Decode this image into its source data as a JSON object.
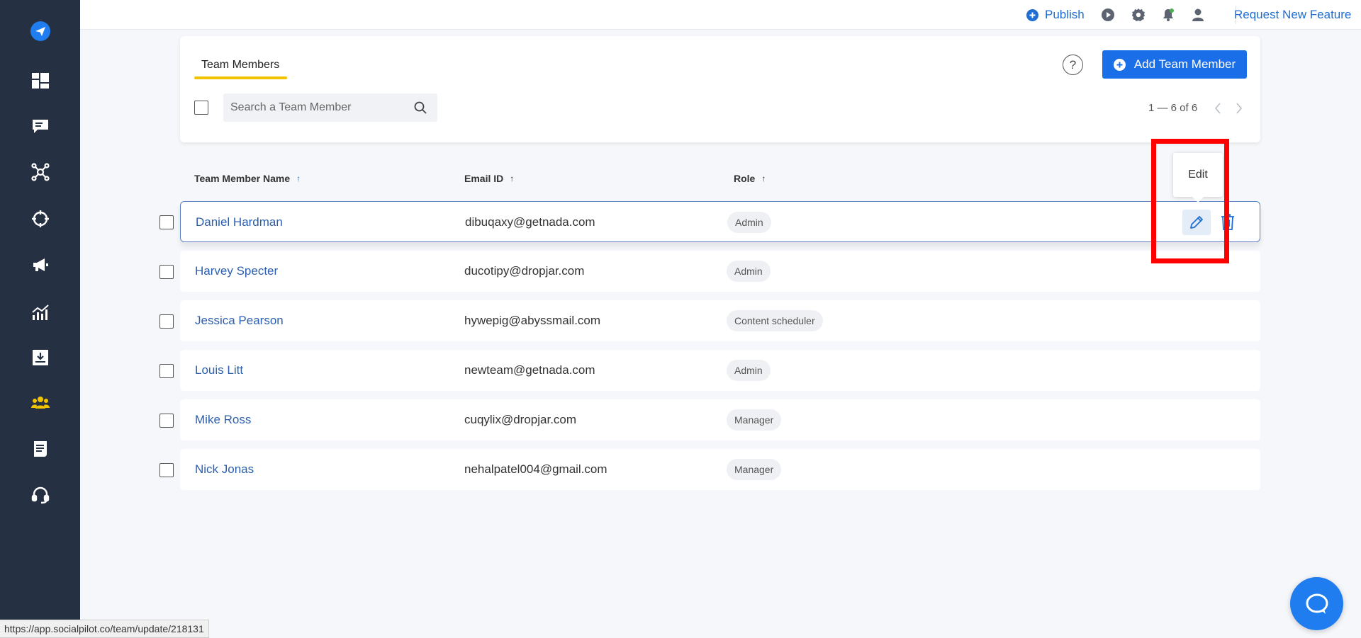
{
  "sidebar": {
    "items": [
      {
        "icon": "send-logo-icon",
        "active": true
      },
      {
        "icon": "dashboard-icon"
      },
      {
        "icon": "messages-icon"
      },
      {
        "icon": "connections-icon"
      },
      {
        "icon": "target-icon"
      },
      {
        "icon": "megaphone-icon"
      },
      {
        "icon": "analytics-icon"
      },
      {
        "icon": "inbox-download-icon"
      },
      {
        "icon": "team-icon",
        "active": true
      },
      {
        "icon": "reports-icon"
      },
      {
        "icon": "support-headset-icon"
      }
    ],
    "colors": {
      "bg": "#253042",
      "icon": "#ffffff",
      "active_accent": "#f2c300"
    }
  },
  "topbar": {
    "publish_label": "Publish",
    "request_label": "Request New Feature",
    "icons": [
      "play-icon",
      "gear-icon",
      "bell-icon",
      "user-icon"
    ]
  },
  "panel": {
    "tab_label": "Team Members",
    "help_icon": "?",
    "add_button_label": "Add Team Member",
    "search_placeholder": "Search a Team Member",
    "pagination": "1 — 6 of 6"
  },
  "table": {
    "headers": {
      "name": "Team Member Name",
      "email": "Email ID",
      "role": "Role"
    },
    "sort_arrow": "↑",
    "rows": [
      {
        "name": "Daniel Hardman",
        "email": "dibuqaxy@getnada.com",
        "role": "Admin"
      },
      {
        "name": "Harvey Specter",
        "email": "ducotipy@dropjar.com",
        "role": "Admin"
      },
      {
        "name": "Jessica Pearson",
        "email": "hywepig@abyssmail.com",
        "role": "Content scheduler"
      },
      {
        "name": "Louis Litt",
        "email": "newteam@getnada.com",
        "role": "Admin"
      },
      {
        "name": "Mike Ross",
        "email": "cuqylix@dropjar.com",
        "role": "Manager"
      },
      {
        "name": "Nick Jonas",
        "email": "nehalpatel004@gmail.com",
        "role": "Manager"
      }
    ]
  },
  "tooltip": {
    "label": "Edit"
  },
  "statusbar": {
    "url": "https://app.socialpilot.co/team/update/218131"
  },
  "colors": {
    "primary": "#1a6ee8",
    "link": "#2c5fad",
    "highlight": "#ff0000"
  }
}
